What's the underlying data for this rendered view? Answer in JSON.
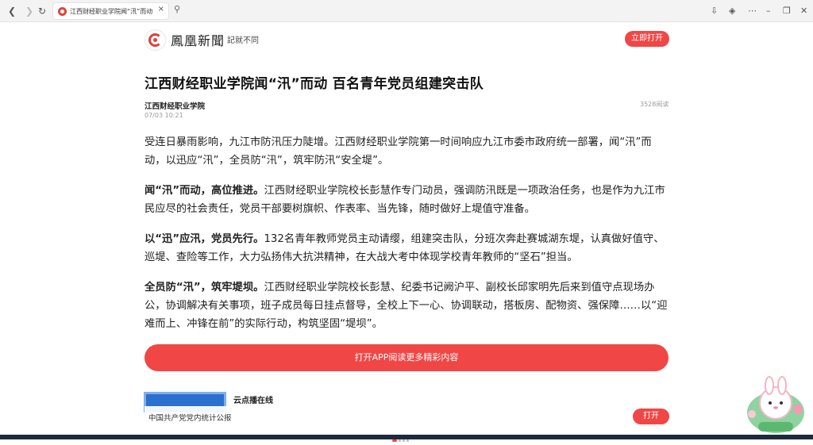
{
  "browser": {
    "back_icon": "arrow-left-icon",
    "forward_icon": "arrow-right-icon",
    "reload_icon": "reload-icon",
    "tab_title": "江西财经职业学院闻“汛”而动",
    "tab_close": "×",
    "search_icon": "magnifier-icon",
    "window_controls": [
      "download-icon",
      "globe-icon",
      "more-icon",
      "minimize-icon",
      "restore-icon",
      "close-icon"
    ]
  },
  "header": {
    "brand_name": "鳳凰新聞",
    "brand_slogan": "記就不同",
    "open_now_label": "立即打开"
  },
  "article": {
    "title": "江西财经职业学院闻“汛”而动 百名青年党员组建突击队",
    "author": "江西财经职业学院",
    "date": "07/03 10:21",
    "reads": "3528阅读",
    "p1": "受连日暴雨影响，九江市防汛压力陡增。江西财经职业学院第一时间响应九江市委市政府统一部署，闻“汛”而动，以迅应“汛”，全员防“汛”，筑牢防汛“安全堤”。",
    "p2_bold": "闻“汛”而动，高位推进。",
    "p2_text": "江西财经职业学院校长彭慧作专门动员，强调防汛既是一项政治任务，也是作为九江市民应尽的社会责任，党员干部要树旗帜、作表率、当先锋，随时做好上堤值守准备。",
    "p3_bold": "以“迅”应汛，党员先行。",
    "p3_text": "132名青年教师党员主动请缨，组建突击队，分班次奔赴赛城湖东堤，认真做好值守、巡堤、查险等工作，大力弘扬伟大抗洪精神，在大战大考中体现学校青年教师的“坚石”担当。",
    "p4_bold": "全员防“汛”，筑牢堤坝。",
    "p4_text": "江西财经职业学院校长彭慧、纪委书记阙沪平、副校长邱家明先后来到值守点现场办公，协调解决有关事项，班子成员每日挂点督导，全校上下一心、协调联动，搭板房、配物资、强保障……以“迎难而上、冲锋在前”的实际行动，构筑坚固“堤坝”。"
  },
  "cta": {
    "app_button_label": "打开APP阅读更多精彩内容"
  },
  "related": {
    "title": "云点播在线",
    "bottom_text": "中国共产党党内统计公报",
    "open_label": "打开"
  }
}
